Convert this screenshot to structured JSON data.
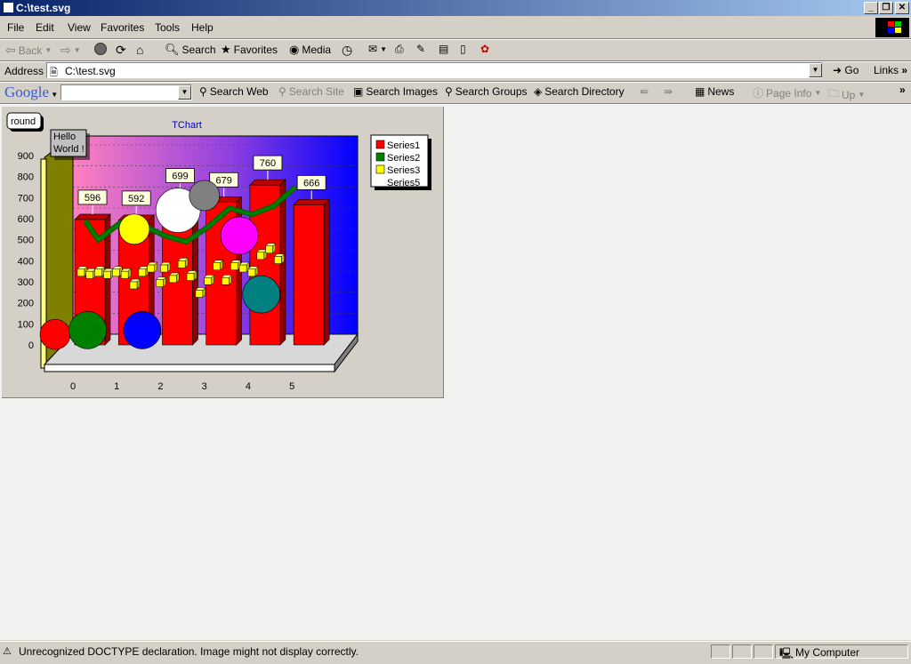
{
  "window": {
    "title": "C:\\test.svg"
  },
  "menu": {
    "items": [
      "File",
      "Edit",
      "View",
      "Favorites",
      "Tools",
      "Help"
    ]
  },
  "toolbar": {
    "back": "Back",
    "search": "Search",
    "favorites": "Favorites",
    "media": "Media"
  },
  "address": {
    "label": "Address",
    "value": "C:\\test.svg",
    "go": "Go",
    "links": "Links"
  },
  "google": {
    "logo": "Google",
    "buttons": [
      "Search Web",
      "Search Site",
      "Search Images",
      "Search Groups",
      "Search Directory",
      "News",
      "Page Info",
      "Up"
    ]
  },
  "status": {
    "message": "Unrecognized DOCTYPE declaration. Image might not display correctly.",
    "zone": "My Computer"
  },
  "chart_data": {
    "type": "bar",
    "title": "TChart",
    "annotations": [
      "round",
      "Hello",
      "World !"
    ],
    "categories": [
      "0",
      "1",
      "2",
      "3",
      "4",
      "5"
    ],
    "yticks": [
      0,
      100,
      200,
      300,
      400,
      500,
      600,
      700,
      800,
      900
    ],
    "series": [
      {
        "name": "Series1",
        "type": "bar",
        "color": "#ff0000",
        "values": [
          596,
          592,
          699,
          679,
          760,
          666
        ]
      },
      {
        "name": "Series2",
        "type": "bubble",
        "color": "#008000",
        "x": [
          0,
          0.5,
          1.5
        ],
        "values": [
          50,
          70,
          70
        ],
        "colors": [
          "#ff0000",
          "#008000",
          "#0000ff"
        ]
      },
      {
        "name": "Series3",
        "type": "point",
        "color": "#ffff00",
        "points": [
          [
            0.1,
            360
          ],
          [
            0.3,
            350
          ],
          [
            0.5,
            360
          ],
          [
            0.7,
            350
          ],
          [
            0.9,
            360
          ],
          [
            1.1,
            350
          ],
          [
            1.3,
            300
          ],
          [
            1.5,
            360
          ],
          [
            1.7,
            380
          ],
          [
            1.9,
            310
          ],
          [
            2.0,
            380
          ],
          [
            2.2,
            330
          ],
          [
            2.4,
            400
          ],
          [
            2.6,
            340
          ],
          [
            2.8,
            260
          ],
          [
            3.0,
            320
          ],
          [
            3.2,
            390
          ],
          [
            3.4,
            320
          ],
          [
            3.6,
            390
          ],
          [
            3.8,
            380
          ],
          [
            4.0,
            360
          ],
          [
            4.2,
            440
          ],
          [
            4.4,
            470
          ],
          [
            4.6,
            420
          ]
        ]
      },
      {
        "name": "Series5",
        "type": "line",
        "color": "#008000",
        "x": [
          0.2,
          0.5,
          1.0,
          1.5,
          2.0,
          2.5,
          3.0,
          3.5,
          4.0,
          4.5,
          5.0
        ],
        "values": [
          590,
          500,
          580,
          570,
          520,
          490,
          560,
          650,
          620,
          660,
          750
        ]
      }
    ],
    "bubbles_extra": [
      {
        "x": 1.4,
        "y": 550,
        "color": "#ffff00"
      },
      {
        "x": 2.4,
        "y": 640,
        "color": "#ffffff"
      },
      {
        "x": 3.0,
        "y": 710,
        "color": "#808080"
      },
      {
        "x": 3.8,
        "y": 520,
        "color": "#ff00ff"
      },
      {
        "x": 4.3,
        "y": 240,
        "color": "#008080"
      }
    ],
    "ylim": [
      0,
      900
    ],
    "legend": "top-right"
  }
}
